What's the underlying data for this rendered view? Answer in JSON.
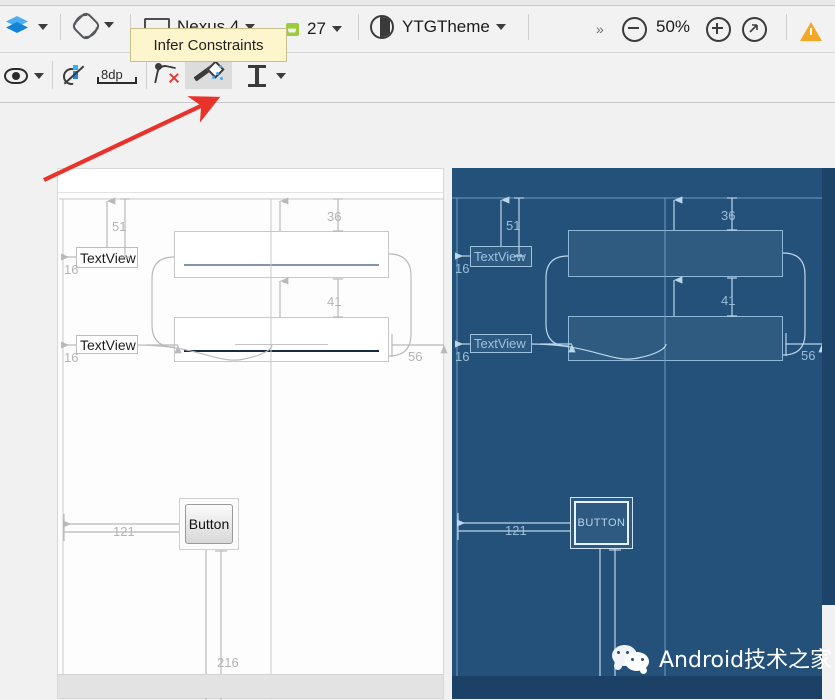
{
  "toolbar": {
    "row1": {
      "layers_icon": "layers-icon",
      "layers_dropdown": "chevron-down-icon",
      "orientation_icon": "rotate-orientation-icon",
      "orientation_dropdown": "chevron-down-icon",
      "device_icon": "device-icon",
      "device_label": "Nexus 4",
      "api_icon": "android-api-icon",
      "api_level": "27",
      "api_dropdown": "chevron-down-icon",
      "theme_icon": "theme-contrast-icon",
      "theme_label": "YTGTheme",
      "theme_dropdown": "chevron-down-icon",
      "overflow_label": "»",
      "zoom_out": "zoom-out-icon",
      "zoom_level": "50%",
      "zoom_in": "zoom-in-icon",
      "zoom_fit": "zoom-fit-icon",
      "warning_icon": "warning-icon"
    },
    "row2": {
      "visibility_icon": "eye-icon",
      "visibility_dropdown": "chevron-down-icon",
      "autoconnect_icon": "autoconnect-off-icon",
      "default_margin_label": "8dp",
      "clear_constraints_icon": "clear-constraints-icon",
      "infer_constraints_icon": "infer-constraints-wand-icon",
      "margins_icon": "vertical-margins-icon",
      "margins_dropdown": "chevron-down-icon"
    }
  },
  "tooltip": {
    "text": "Infer Constraints"
  },
  "annotation": {
    "arrow_color": "#e8322a",
    "highlight_color": "#e02b2b"
  },
  "design_panel": {
    "label": "design-surface",
    "widgets": {
      "textview1": "TextView",
      "textview2": "TextView",
      "button": "Button"
    },
    "dimensions": {
      "tv1_top": "51",
      "tv1_left": "16",
      "tv2_left": "16",
      "field1_top": "36",
      "field2_top": "41",
      "field2_right": "56",
      "button_left": "121",
      "button_bottom": "216"
    }
  },
  "blueprint_panel": {
    "label": "blueprint-surface",
    "widgets": {
      "textview1": "TextView",
      "textview2": "TextView",
      "button": "BUTTON"
    },
    "dimensions": {
      "tv1_top": "51",
      "tv1_left": "16",
      "tv2_left": "16",
      "field1_top": "36",
      "field2_top": "41",
      "field2_right": "56",
      "button_left": "121"
    }
  },
  "watermark": {
    "icon": "wechat-icon",
    "text": "Android技术之家"
  },
  "colors": {
    "blueprint_bg": "#23517a",
    "blueprint_stroke": "#9dc2e0",
    "accent_blue": "#2196f3",
    "warning": "#f5a623",
    "annotation_red": "#e8322a"
  }
}
